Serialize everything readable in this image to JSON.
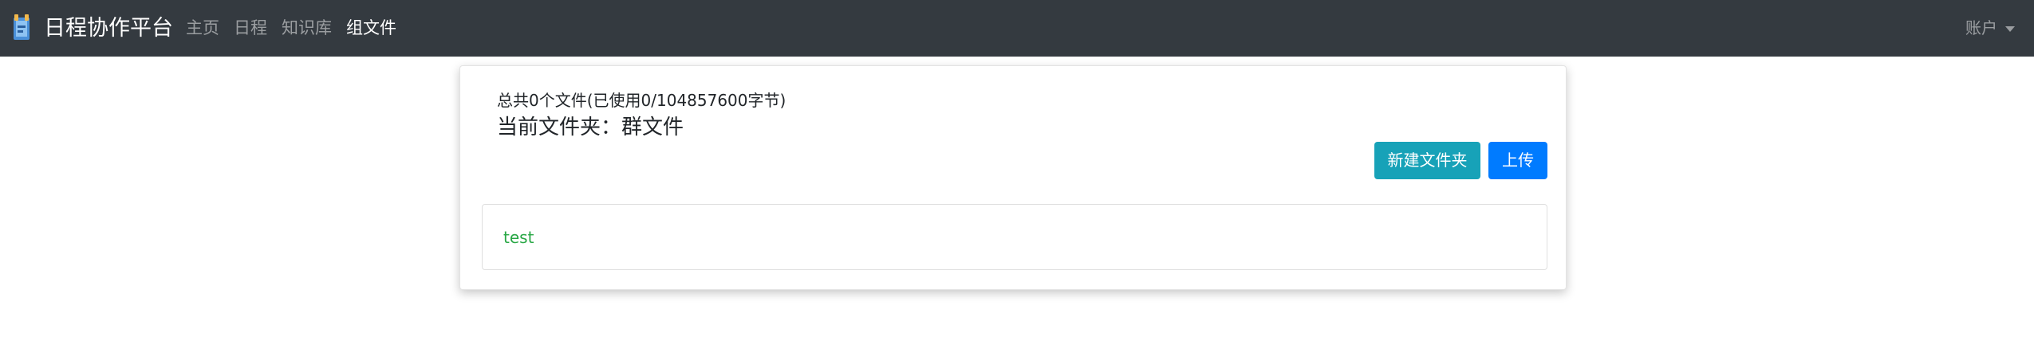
{
  "navbar": {
    "brand": "日程协作平台",
    "links": [
      {
        "label": "主页"
      },
      {
        "label": "日程"
      },
      {
        "label": "知识库"
      },
      {
        "label": "组文件"
      }
    ],
    "account_label": "账户"
  },
  "files": {
    "summary": "总共0个文件(已使用0/104857600字节)",
    "current_folder": "当前文件夹：群文件",
    "new_folder_label": "新建文件夹",
    "upload_label": "上传",
    "items": [
      {
        "name": "test"
      }
    ]
  },
  "colors": {
    "navbar_bg": "#343a40",
    "info_button": "#17a2b8",
    "primary_button": "#007bff",
    "file_link": "#28a745"
  }
}
